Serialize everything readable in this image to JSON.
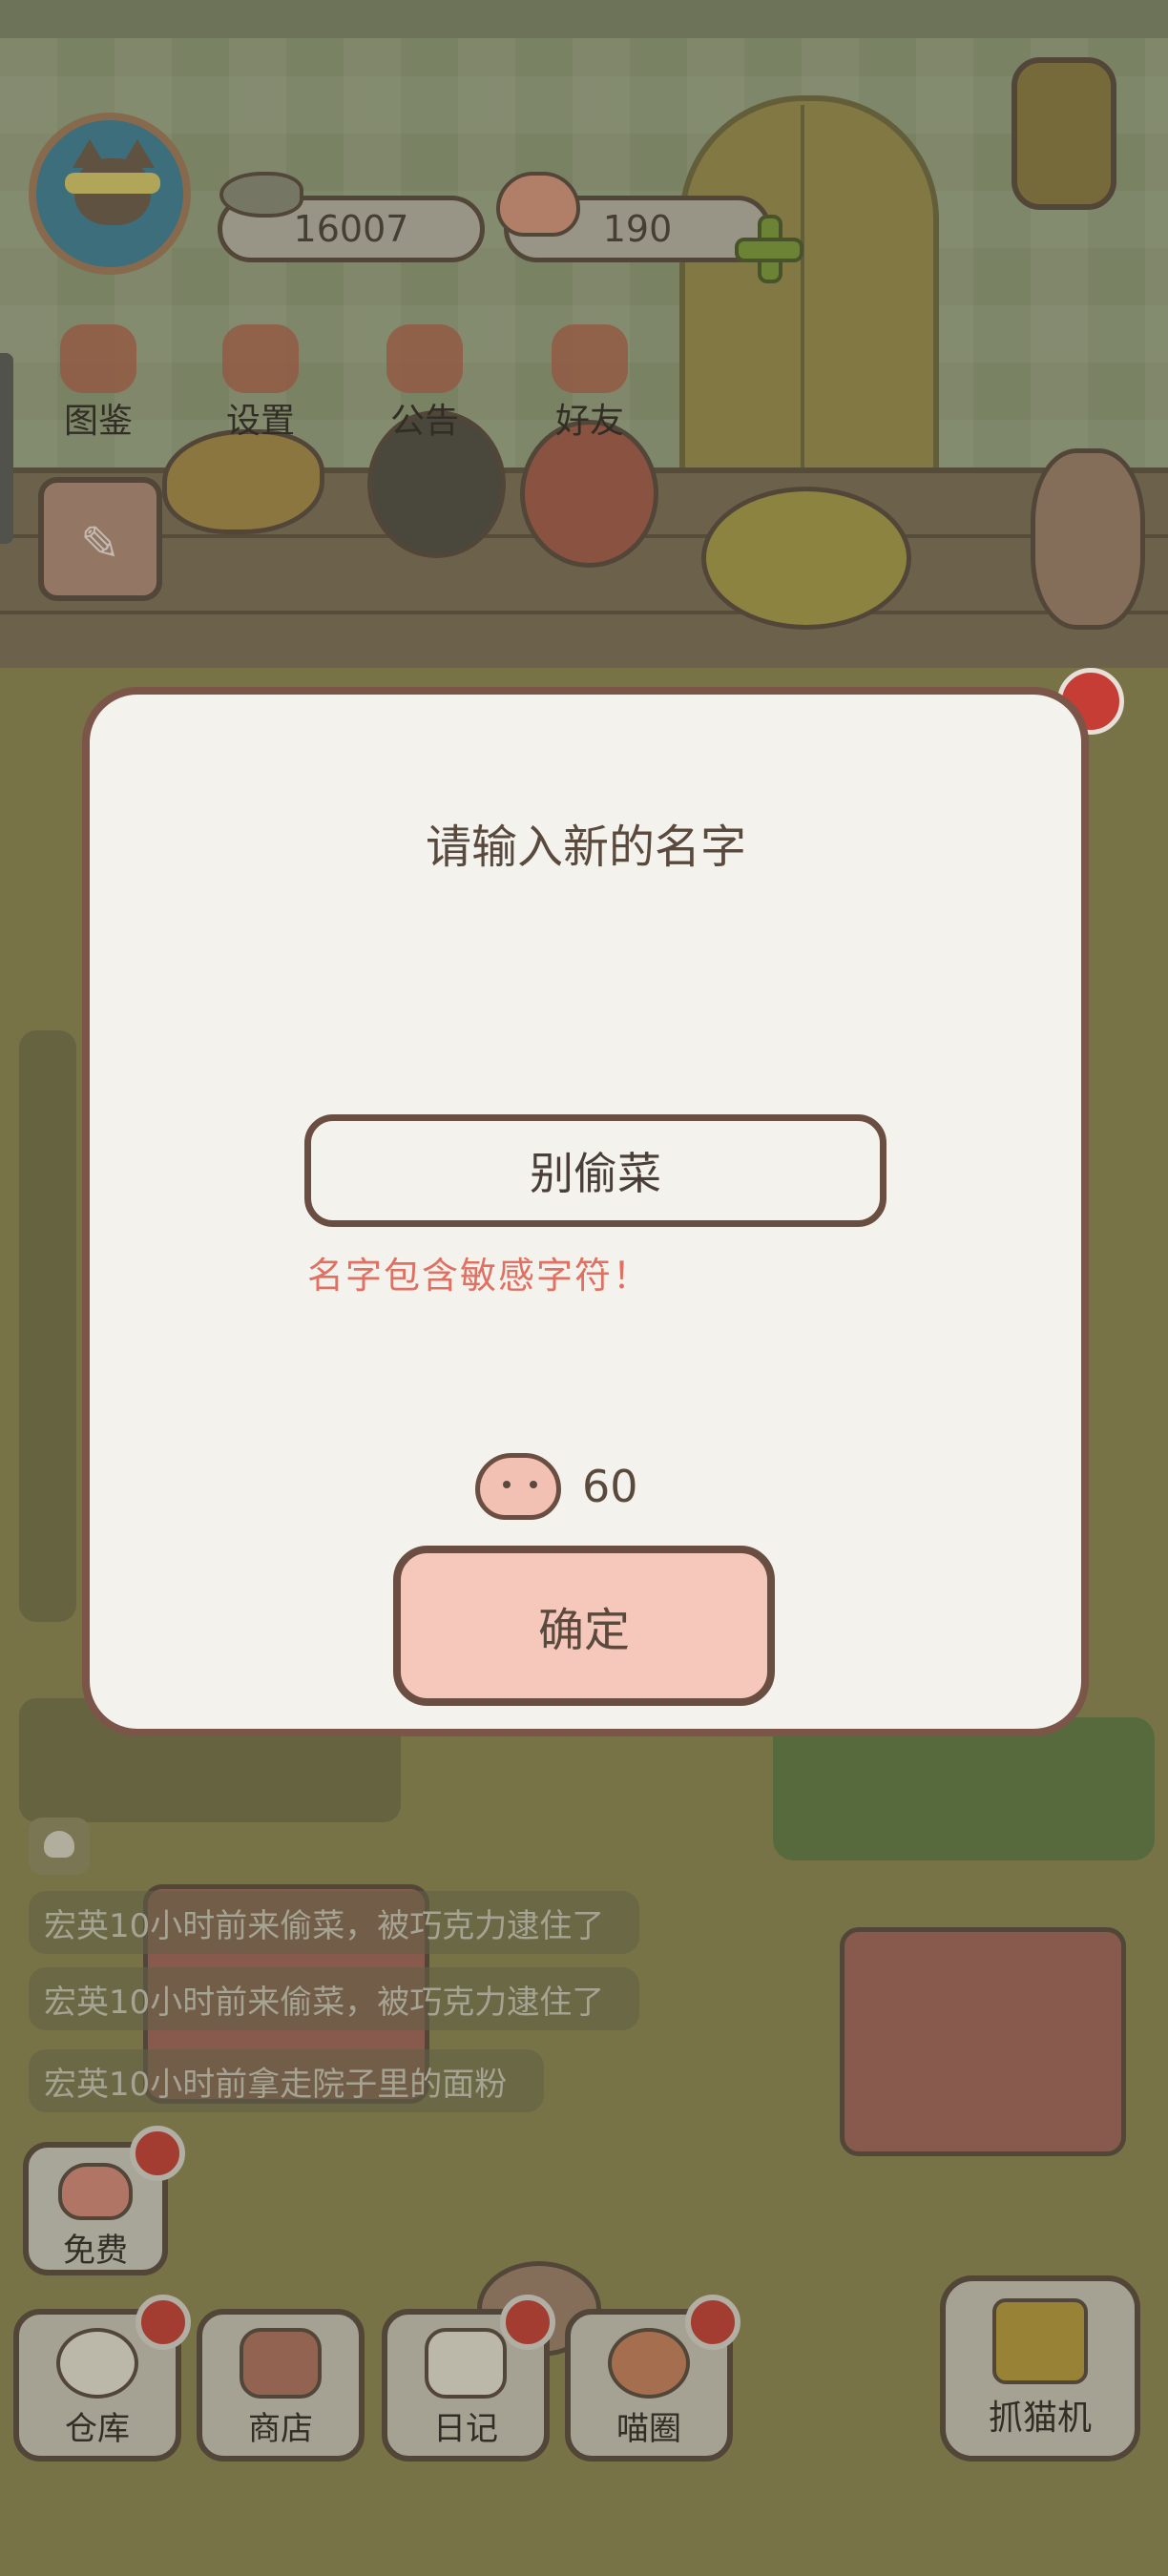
{
  "header": {
    "coins": "16007",
    "hearts": "190"
  },
  "top_menu": [
    {
      "label": "图鉴",
      "icon": "cat-book-icon"
    },
    {
      "label": "设置",
      "icon": "gear-icon"
    },
    {
      "label": "公告",
      "icon": "gift-icon"
    },
    {
      "label": "好友",
      "icon": "friends-icon"
    }
  ],
  "dialog": {
    "title": "请输入新的名字",
    "input_value": "别偷菜",
    "error": "名字包含敏感字符！",
    "cost": "60",
    "confirm_label": "确定"
  },
  "feed": [
    "宏英10小时前来偷菜，被巧克力逮住了",
    "宏英10小时前来偷菜，被巧克力逮住了",
    "宏英10小时前拿走院子里的面粉"
  ],
  "bottom_bar": {
    "free_label": "免费",
    "items": [
      {
        "label": "仓库",
        "icon": "warehouse-icon"
      },
      {
        "label": "商店",
        "icon": "shop-icon"
      },
      {
        "label": "日记",
        "icon": "diary-icon"
      },
      {
        "label": "喵圈",
        "icon": "planet-cat-icon"
      }
    ],
    "claw_label": "抓猫机"
  },
  "colors": {
    "modal_bg": "#f4f2ed",
    "modal_border": "#7a5548",
    "error_text": "#e07062",
    "confirm_bg": "#f6c8bb",
    "notification_dot": "#c63d35"
  }
}
